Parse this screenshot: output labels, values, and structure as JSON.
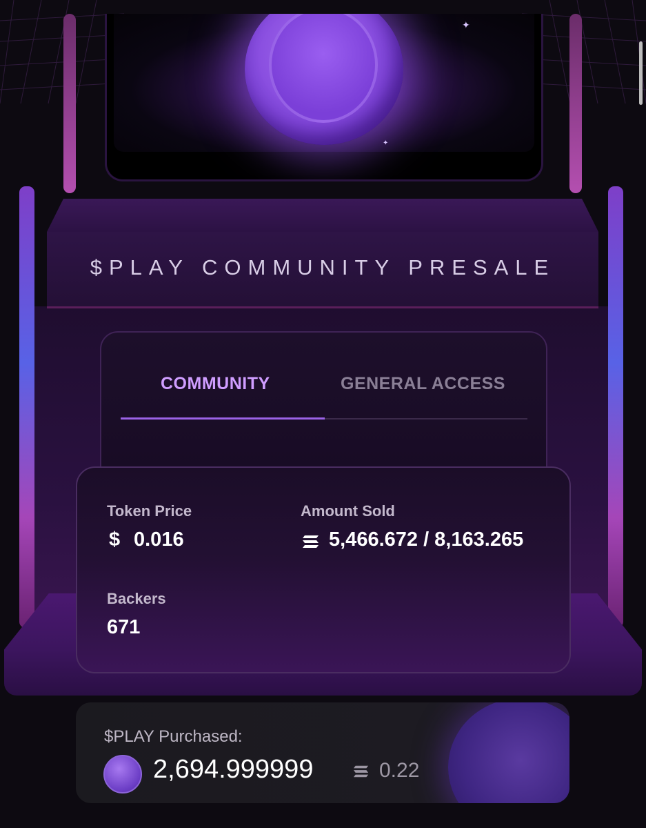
{
  "cabinet": {
    "marquee_title": "$PLAY COMMUNITY PRESALE"
  },
  "tabs": [
    {
      "label": "COMMUNITY",
      "active": true
    },
    {
      "label": "GENERAL ACCESS",
      "active": false
    }
  ],
  "stats": {
    "token_price": {
      "label": "Token Price",
      "currency_icon": "$",
      "value": "0.016"
    },
    "amount_sold": {
      "label": "Amount Sold",
      "icon": "solana-icon",
      "value": "5,466.672 / 8,163.265"
    },
    "backers": {
      "label": "Backers",
      "value": "671"
    }
  },
  "purchased": {
    "label": "$PLAY Purchased:",
    "amount": "2,694.999999",
    "sol_value": "0.22",
    "token_icon": "play-coin-icon",
    "sol_icon": "solana-icon"
  },
  "colors": {
    "accent": "#9b63e6",
    "active_tab": "#cf9dff",
    "inactive_tab": "#8a7f96",
    "background": "#0d0a11"
  }
}
